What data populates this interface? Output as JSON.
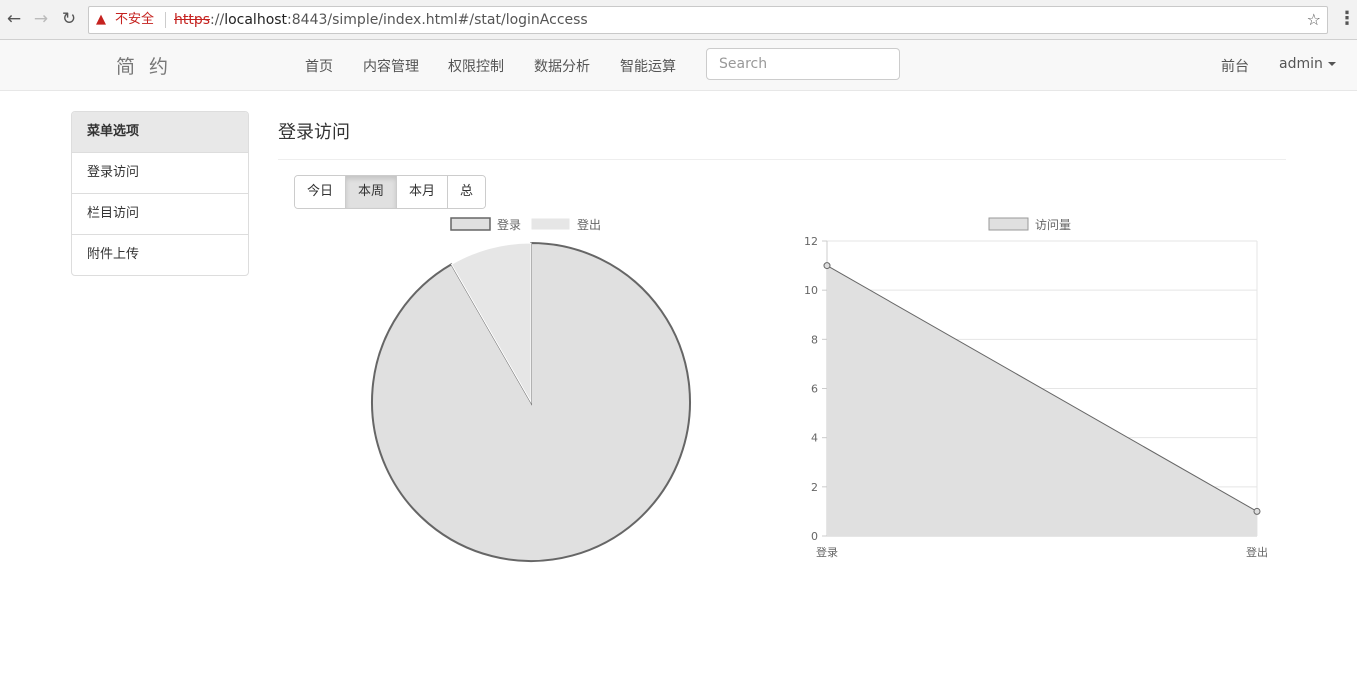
{
  "browser": {
    "insecure_label": "不安全",
    "url_scheme": "https",
    "url_sep": "://",
    "url_host": "localhost",
    "url_rest": ":8443/simple/index.html#/stat/loginAccess"
  },
  "navbar": {
    "brand": "简 约",
    "items": [
      {
        "label": "首页"
      },
      {
        "label": "内容管理"
      },
      {
        "label": "权限控制"
      },
      {
        "label": "数据分析"
      },
      {
        "label": "智能运算"
      }
    ],
    "search_placeholder": "Search",
    "frontend_label": "前台",
    "user_label": "admin"
  },
  "sidebar": {
    "heading": "菜单选项",
    "items": [
      {
        "label": "登录访问"
      },
      {
        "label": "栏目访问"
      },
      {
        "label": "附件上传"
      }
    ]
  },
  "main": {
    "title": "登录访问",
    "periods": [
      {
        "label": "今日",
        "active": false
      },
      {
        "label": "本周",
        "active": true
      },
      {
        "label": "本月",
        "active": false
      },
      {
        "label": "总",
        "active": false
      }
    ]
  },
  "chart_data": [
    {
      "type": "pie",
      "categories": [
        "登录",
        "登出"
      ],
      "values": [
        11,
        1
      ],
      "legend": [
        "登录",
        "登出"
      ],
      "legend_position": "top",
      "colors": [
        "#e0e0e0",
        "#e6e6e6"
      ],
      "border_colors": [
        "#666666",
        "#ffffff"
      ]
    },
    {
      "type": "area",
      "categories": [
        "登录",
        "登出"
      ],
      "series": [
        {
          "name": "访问量",
          "values": [
            11,
            1
          ]
        }
      ],
      "ylim": [
        0,
        12
      ],
      "yticks": [
        0,
        2,
        4,
        6,
        8,
        10,
        12
      ],
      "grid": true,
      "legend_position": "top",
      "fill_color": "#e0e0e0",
      "line_color": "#666666"
    }
  ]
}
